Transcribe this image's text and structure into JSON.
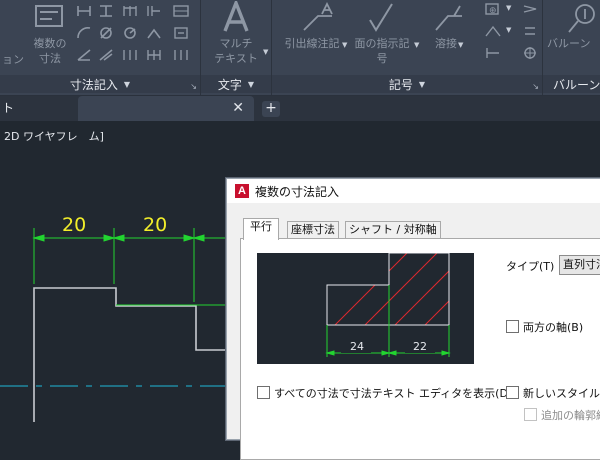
{
  "ribbon": {
    "panels": [
      {
        "title": "寸法記入",
        "tool_label": "複数の\n寸法",
        "caret": "▼",
        "launcher": "↘"
      },
      {
        "title": "文字",
        "tool_label": "マルチ\nテキスト",
        "caret": "▼",
        "launcher": "↘"
      },
      {
        "title": "記号",
        "caret": "▼",
        "launcher": "↘",
        "tools": [
          "引出線注記",
          "面の指示記\n号",
          "溶接"
        ]
      },
      {
        "title": "バルーン",
        "tool_label": "バルーン"
      }
    ],
    "left_cut_text": "ョン"
  },
  "tabs": {
    "previous_tab_label": "ト",
    "active_tab_label": "",
    "close_glyph": "✕",
    "add_glyph": "+"
  },
  "viewport_label": "2D ワイヤフレ　ム]",
  "drawing": {
    "dimensions": [
      "20",
      "20"
    ]
  },
  "dialog": {
    "title": "複数の寸法記入",
    "app_icon_letter": "A",
    "tabs": [
      "平行",
      "座標寸法",
      "シャフト / 対称軸"
    ],
    "type_label": "タイプ(T)",
    "type_value": "直列寸法",
    "both_axes_label": "両方の軸(B)",
    "show_editor_label": "すべての寸法で寸法テキスト エディタを表示(D)",
    "new_style_label": "新しいスタイルで",
    "additional_label": "追加の輪郭線",
    "preview_dimensions": [
      "24",
      "22"
    ]
  },
  "colors": {
    "ribbon_bg": "#3b4453",
    "canvas_bg": "#212830",
    "dimension_green": "#22d430",
    "dimension_text": "#f2ee2a",
    "center_line": "#1fb8d8",
    "hatch_red": "#e0292e"
  }
}
